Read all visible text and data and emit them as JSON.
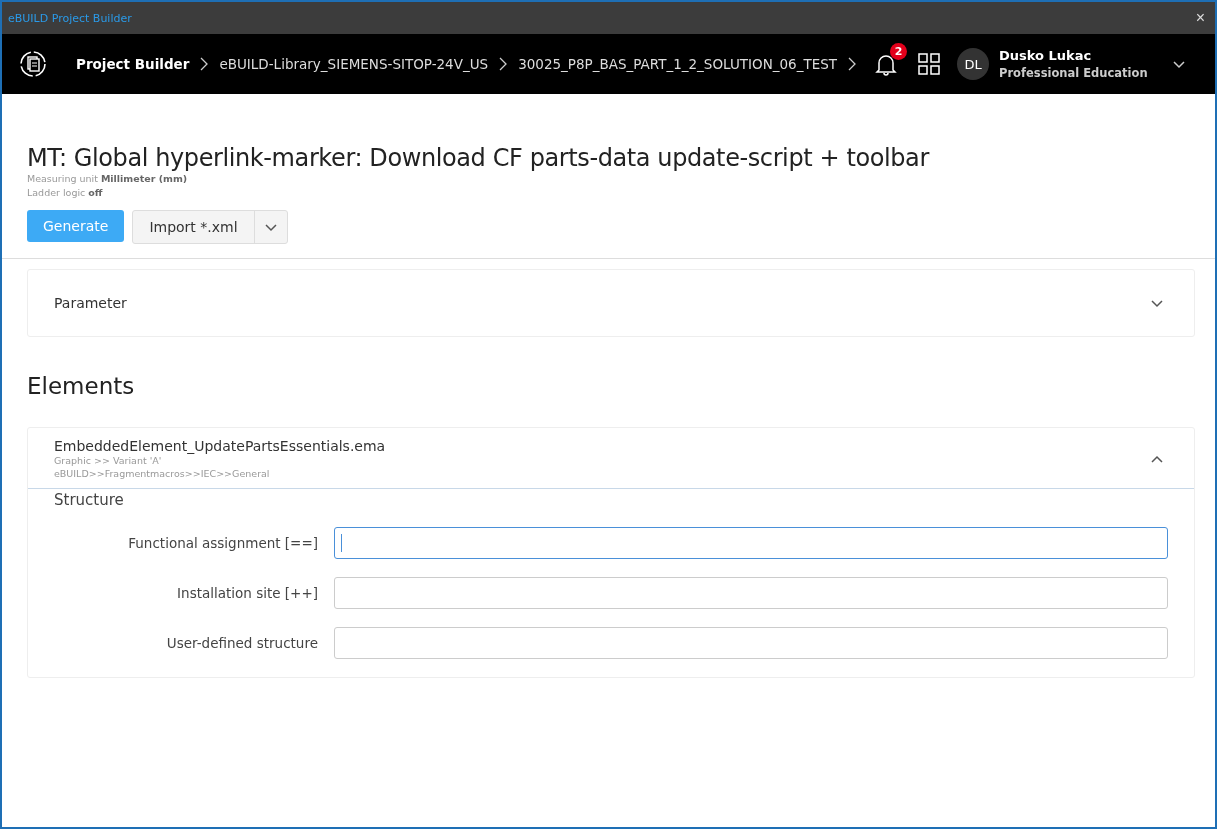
{
  "window": {
    "title": "eBUILD Project Builder",
    "close": "×"
  },
  "header": {
    "breadcrumbs": [
      "Project Builder",
      "eBUILD-Library_SIEMENS-SITOP-24V_US",
      "30025_P8P_BAS_PART_1_2_SOLUTION_06_TEST"
    ],
    "notifications": "2",
    "user": {
      "initials": "DL",
      "name": "Dusko Lukac",
      "role": "Professional Education"
    }
  },
  "project": {
    "title": "MT: Global hyperlink-marker: Download CF parts-data update-script + toolbar",
    "meta": [
      "Measuring unit **Millimeter (mm)**",
      "Ladder logic **off**"
    ],
    "buttons": [
      {
        "label": "Generate",
        "kind": "primary"
      },
      {
        "label": "Import *.xml",
        "kind": "split"
      }
    ]
  },
  "parameter": {
    "label": "Parameter",
    "expanded": false
  },
  "elements": {
    "heading": "Elements",
    "items": [
      {
        "name": "EmbeddedElement_UpdatePartsEssentials.ema",
        "details": [
          "Graphic >> Variant 'A'",
          "eBUILD>>Fragmentmacros>>IEC>>General"
        ],
        "expanded": true,
        "section": "Structure",
        "fields": [
          {
            "label": "Functional assignment [==]",
            "focused": true
          },
          {
            "label": "Installation site [++]",
            "focused": false
          },
          {
            "label": "User-defined structure",
            "focused": false
          }
        ]
      }
    ]
  }
}
